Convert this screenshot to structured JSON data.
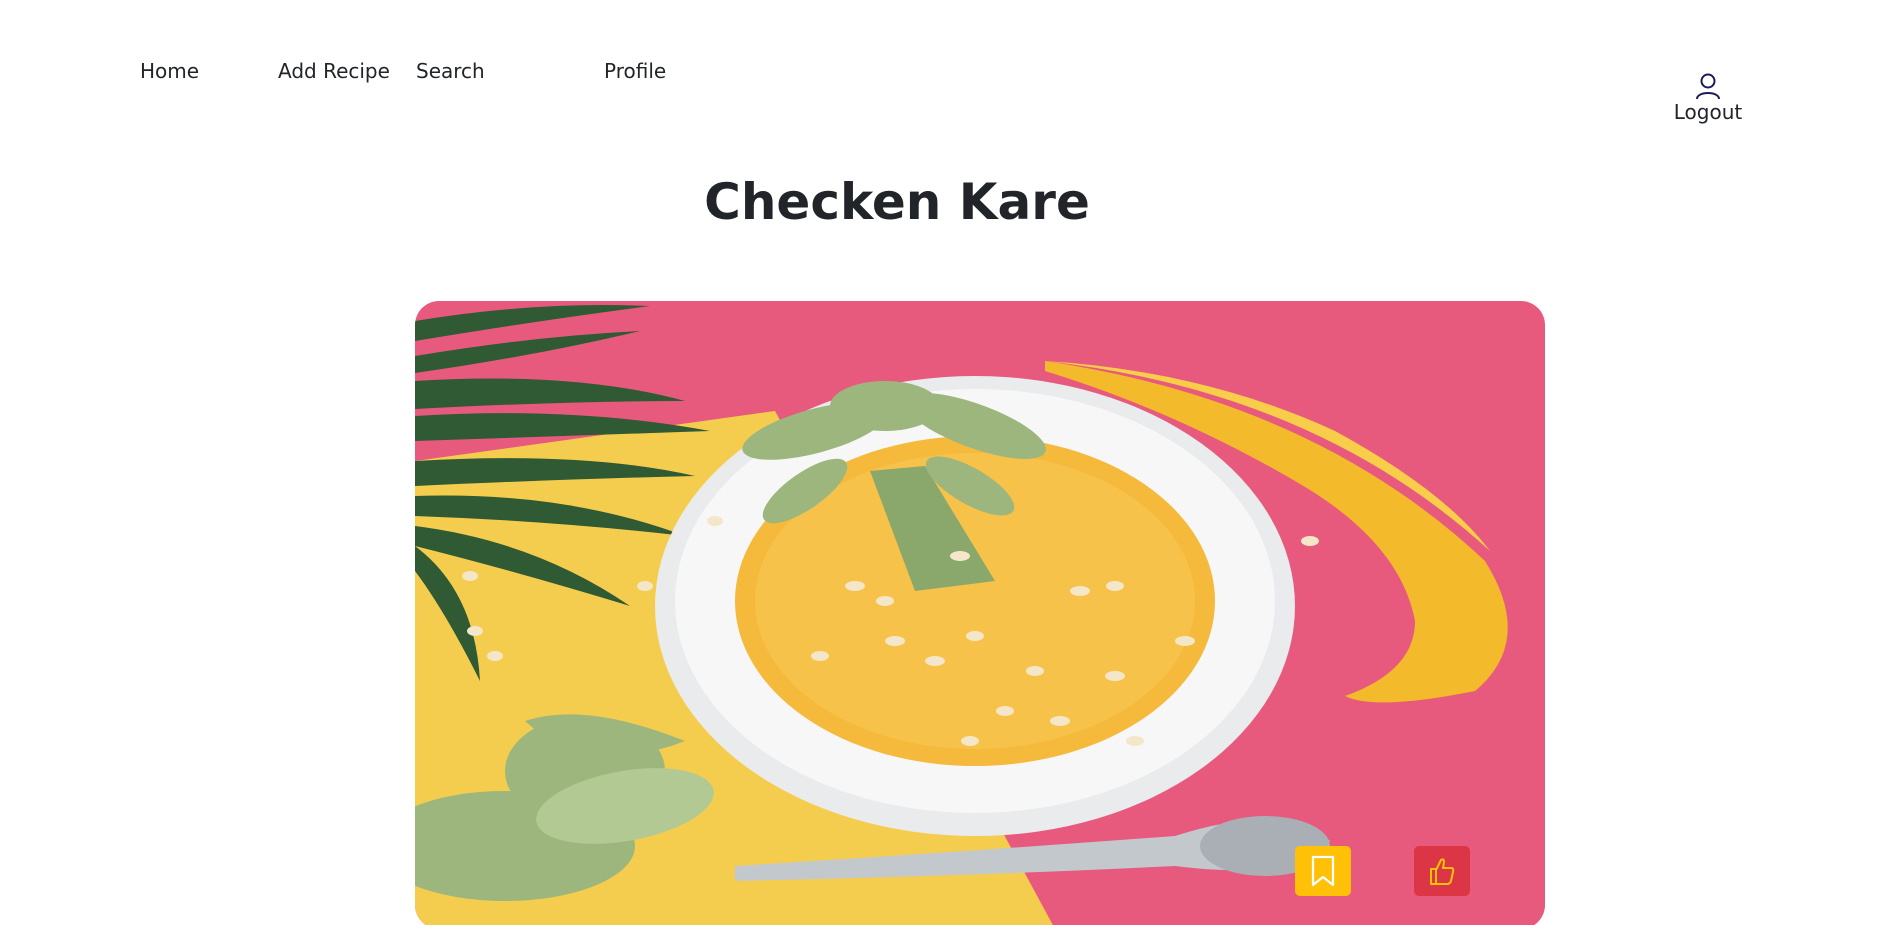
{
  "nav": {
    "home": "Home",
    "add_recipe": "Add Recipe",
    "search": "Search",
    "profile": "Profile",
    "logout": "Logout"
  },
  "recipe": {
    "title": "Checken Kare"
  },
  "icons": {
    "logout": "user-icon",
    "save": "bookmark-icon",
    "like": "thumbs-up-icon"
  },
  "colors": {
    "save_button": "#ffc107",
    "like_button": "#dc3545",
    "save_icon": "#ffffff",
    "like_icon": "#ffc107"
  }
}
